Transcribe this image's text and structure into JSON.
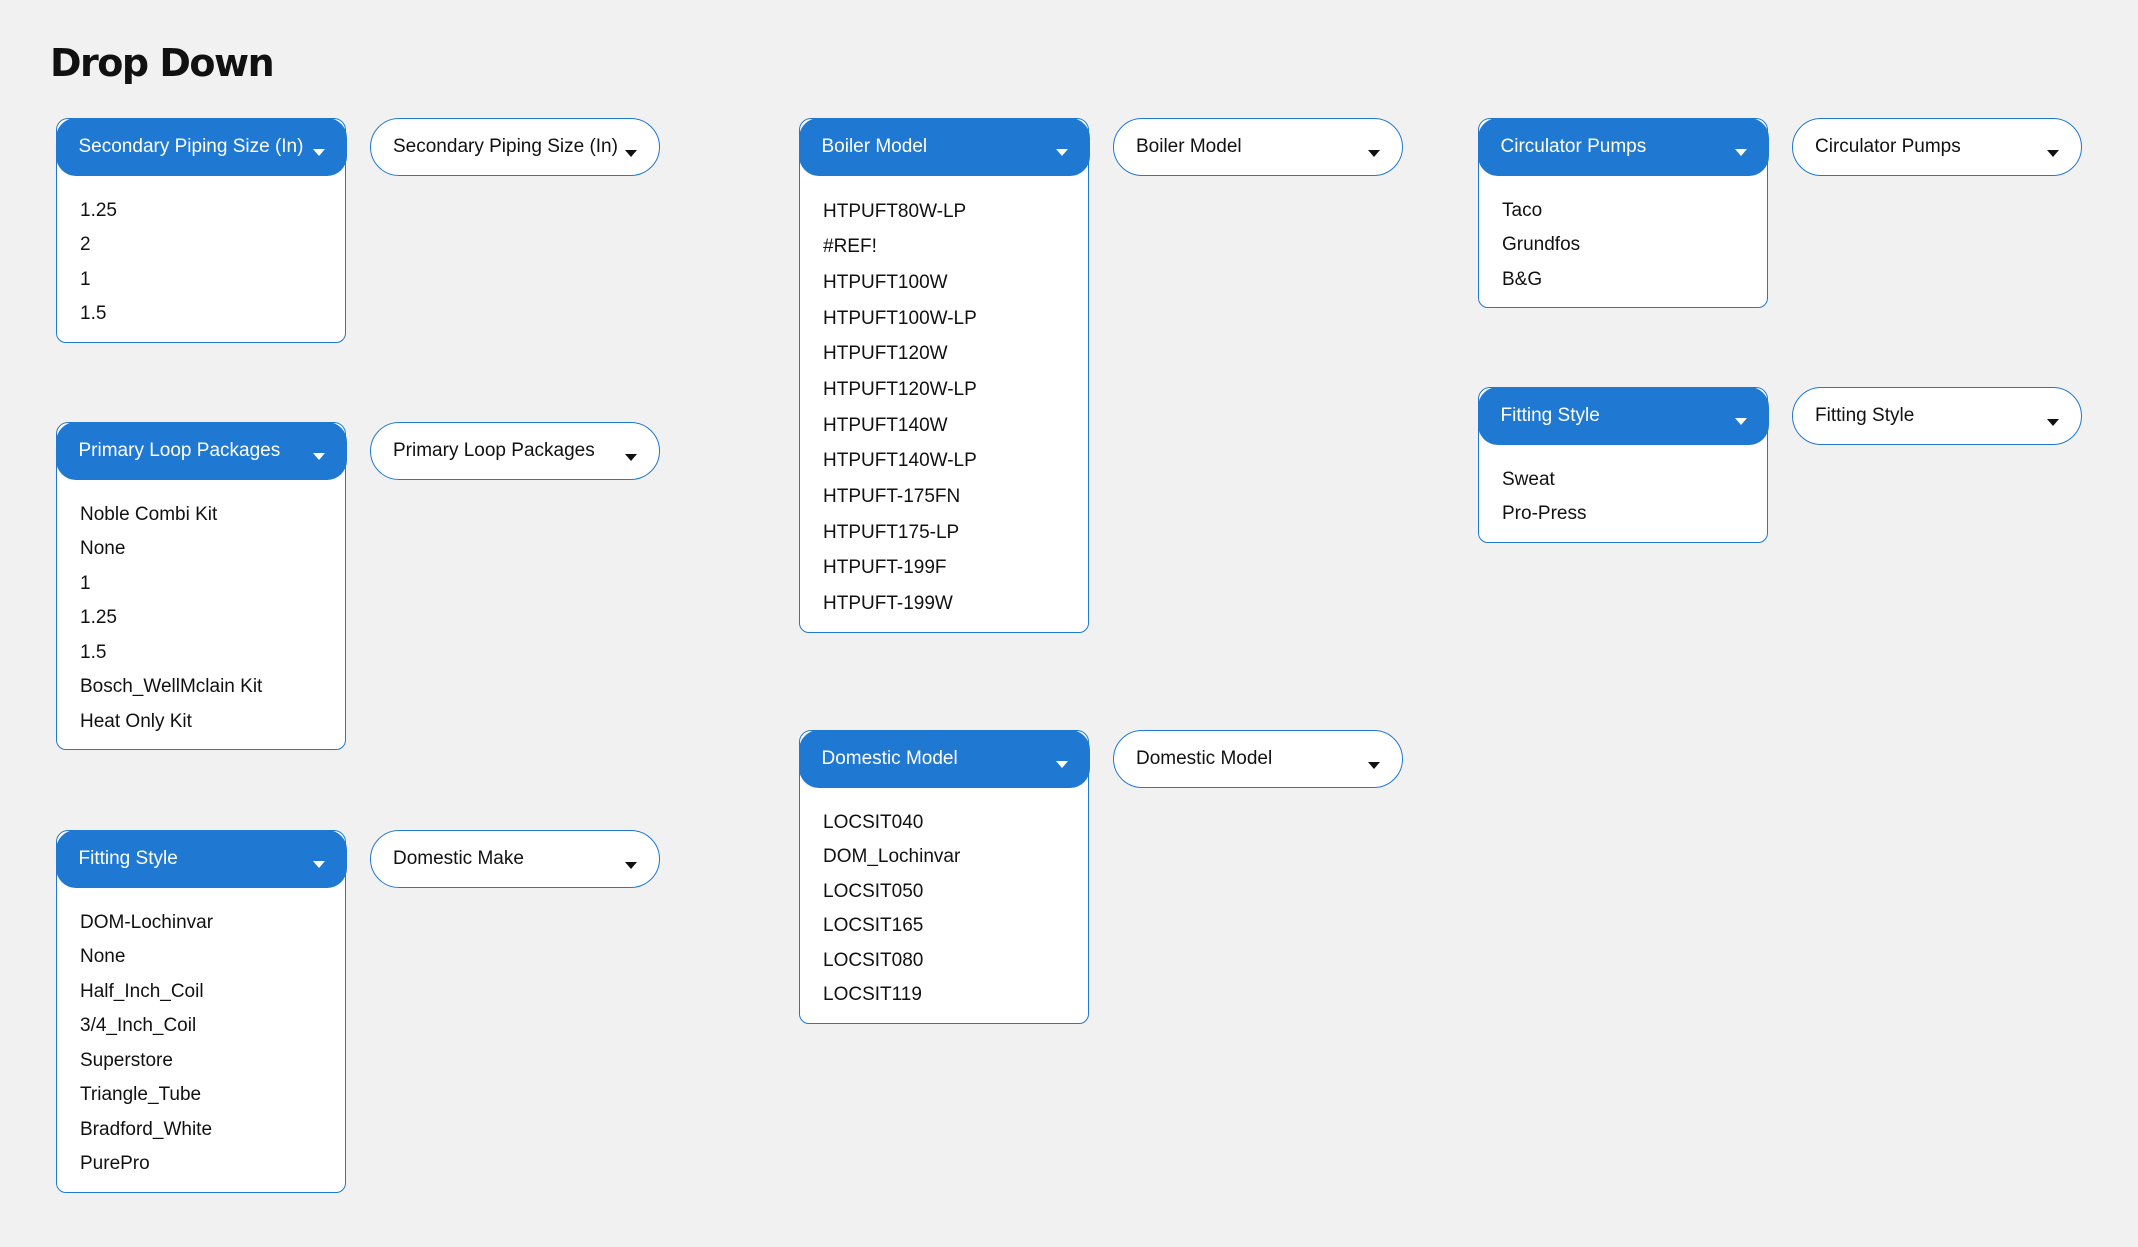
{
  "page": {
    "title": "Drop Down"
  },
  "open_dropdowns": {
    "secondary_piping": {
      "label": "Secondary Piping Size (In)",
      "items": [
        "1.25",
        "2",
        "1",
        "1.5"
      ]
    },
    "primary_loop": {
      "label": "Primary Loop Packages",
      "items": [
        "Noble Combi Kit",
        "None",
        "1",
        "1.25",
        "1.5",
        "Bosch_WellMclain Kit",
        "Heat Only Kit"
      ]
    },
    "fitting_style_left": {
      "label": "Fitting Style",
      "items": [
        "DOM-Lochinvar",
        "None",
        "Half_Inch_Coil",
        "3/4_Inch_Coil",
        "Superstore",
        "Triangle_Tube",
        "Bradford_White",
        "PurePro"
      ]
    },
    "boiler_model": {
      "label": "Boiler Model",
      "items": [
        "HTPUFT80W-LP",
        "#REF!",
        "HTPUFT100W",
        "HTPUFT100W-LP",
        "HTPUFT120W",
        "HTPUFT120W-LP",
        "HTPUFT140W",
        "HTPUFT140W-LP",
        "HTPUFT-175FN",
        "HTPUFT175-LP",
        "HTPUFT-199F",
        "HTPUFT-199W"
      ]
    },
    "domestic_model": {
      "label": "Domestic Model",
      "items": [
        "LOCSIT040",
        "DOM_Lochinvar",
        "LOCSIT050",
        "LOCSIT165",
        "LOCSIT080",
        "LOCSIT119"
      ]
    },
    "circulator_pumps": {
      "label": "Circulator Pumps",
      "items": [
        "Taco",
        "Grundfos",
        "B&G"
      ]
    },
    "fitting_style_right": {
      "label": "Fitting Style",
      "items": [
        "Sweat",
        "Pro-Press"
      ]
    }
  },
  "closed_dropdowns": {
    "secondary_piping": {
      "label": "Secondary Piping Size (In)"
    },
    "primary_loop": {
      "label": "Primary Loop Packages"
    },
    "domestic_make": {
      "label": "Domestic Make"
    },
    "boiler_model": {
      "label": "Boiler Model"
    },
    "domestic_model": {
      "label": "Domestic Model"
    },
    "circulator_pumps": {
      "label": "Circulator Pumps"
    },
    "fitting_style": {
      "label": "Fitting Style"
    }
  },
  "colors": {
    "accent": "#1f78d1",
    "background": "#f1f1f1"
  },
  "icons": {
    "dropdown_arrow": "caret-down-icon"
  }
}
